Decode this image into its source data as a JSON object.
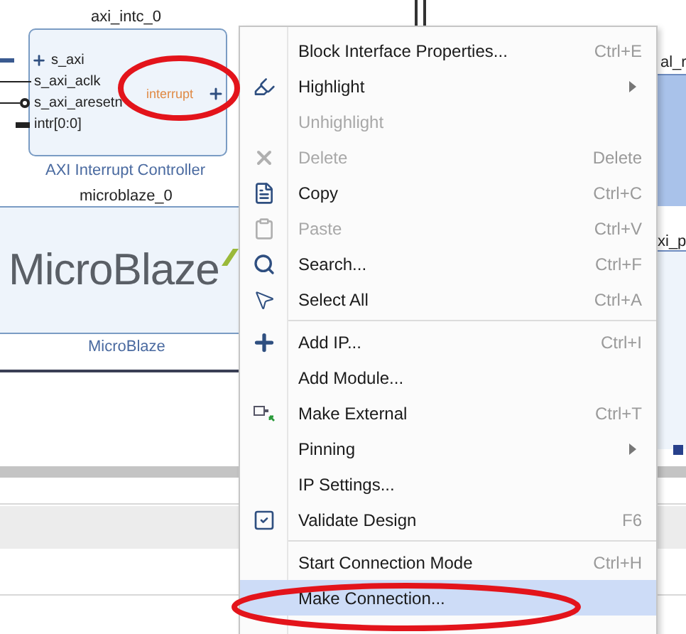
{
  "canvas": {
    "interrupt_block": {
      "instance": "axi_intc_0",
      "ports": [
        "s_axi",
        "s_axi_aclk",
        "s_axi_aresetn",
        "intr[0:0]"
      ],
      "output_port": "interrupt",
      "type_label": "AXI Interrupt Controller"
    },
    "cpu_block": {
      "instance": "microblaze_0",
      "logo": "MicroBlaze",
      "type_label": "MicroBlaze"
    },
    "right_labels": [
      "al_r",
      "xi_p"
    ]
  },
  "context_menu": {
    "items": [
      {
        "kind": "item",
        "label": "Block Interface Properties...",
        "shortcut": "Ctrl+E",
        "disabled": false,
        "submenu": false,
        "selected": false
      },
      {
        "kind": "item",
        "label": "Highlight",
        "disabled": false,
        "submenu": true,
        "selected": false
      },
      {
        "kind": "item",
        "label": "Unhighlight",
        "disabled": true,
        "submenu": false,
        "selected": false
      },
      {
        "kind": "item",
        "label": "Delete",
        "shortcut": "Delete",
        "disabled": true,
        "submenu": false,
        "selected": false
      },
      {
        "kind": "item",
        "label": "Copy",
        "shortcut": "Ctrl+C",
        "disabled": false,
        "submenu": false,
        "selected": false
      },
      {
        "kind": "item",
        "label": "Paste",
        "shortcut": "Ctrl+V",
        "disabled": true,
        "submenu": false,
        "selected": false
      },
      {
        "kind": "item",
        "label": "Search...",
        "shortcut": "Ctrl+F",
        "disabled": false,
        "submenu": false,
        "selected": false
      },
      {
        "kind": "item",
        "label": "Select All",
        "shortcut": "Ctrl+A",
        "disabled": false,
        "submenu": false,
        "selected": false
      },
      {
        "kind": "separator"
      },
      {
        "kind": "item",
        "label": "Add IP...",
        "shortcut": "Ctrl+I",
        "disabled": false,
        "submenu": false,
        "selected": false
      },
      {
        "kind": "item",
        "label": "Add Module...",
        "disabled": false,
        "submenu": false,
        "selected": false
      },
      {
        "kind": "item",
        "label": "Make External",
        "shortcut": "Ctrl+T",
        "disabled": false,
        "submenu": false,
        "selected": false
      },
      {
        "kind": "item",
        "label": "Pinning",
        "disabled": false,
        "submenu": true,
        "selected": false
      },
      {
        "kind": "item",
        "label": "IP Settings...",
        "disabled": false,
        "submenu": false,
        "selected": false
      },
      {
        "kind": "item",
        "label": "Validate Design",
        "shortcut": "F6",
        "disabled": false,
        "submenu": false,
        "selected": false
      },
      {
        "kind": "separator"
      },
      {
        "kind": "item",
        "label": "Start Connection Mode",
        "shortcut": "Ctrl+H",
        "disabled": false,
        "submenu": false,
        "selected": false
      },
      {
        "kind": "item",
        "label": "Make Connection...",
        "disabled": false,
        "submenu": false,
        "selected": true
      }
    ]
  }
}
